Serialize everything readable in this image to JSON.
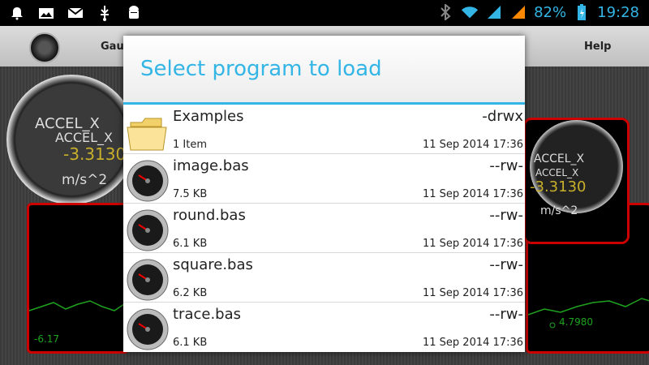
{
  "statusbar": {
    "battery_percent": "82%",
    "time": "19:28",
    "accent_color": "#33b5e5"
  },
  "background_app": {
    "tab_gauges": "Gau",
    "tab_help": "Help",
    "gauge_big": {
      "label1": "ACCEL_X",
      "label2": "ACCEL_X",
      "value": "-3.3130",
      "unit": "m/s^2"
    },
    "gauge_small": {
      "label1": "ACCEL_X",
      "label2": "ACCEL_X",
      "value": "-3.3130",
      "unit": "m/s^2"
    },
    "graph_left_value": "-6.17",
    "graph_right_value": "4.7980"
  },
  "dialog": {
    "title": "Select program to load",
    "items": [
      {
        "name": "Examples",
        "perm": "-drwx",
        "size": "1 Item",
        "date": "11 Sep 2014 17:36",
        "icon": "folder-icon"
      },
      {
        "name": "image.bas",
        "perm": "--rw-",
        "size": "7.5 KB",
        "date": "11 Sep 2014 17:36",
        "icon": "gauge-icon"
      },
      {
        "name": "round.bas",
        "perm": "--rw-",
        "size": "6.1 KB",
        "date": "11 Sep 2014 17:36",
        "icon": "gauge-icon"
      },
      {
        "name": "square.bas",
        "perm": "--rw-",
        "size": "6.2 KB",
        "date": "11 Sep 2014 17:36",
        "icon": "gauge-icon"
      },
      {
        "name": "trace.bas",
        "perm": "--rw-",
        "size": "6.1 KB",
        "date": "11 Sep 2014 17:36",
        "icon": "gauge-icon"
      }
    ]
  }
}
